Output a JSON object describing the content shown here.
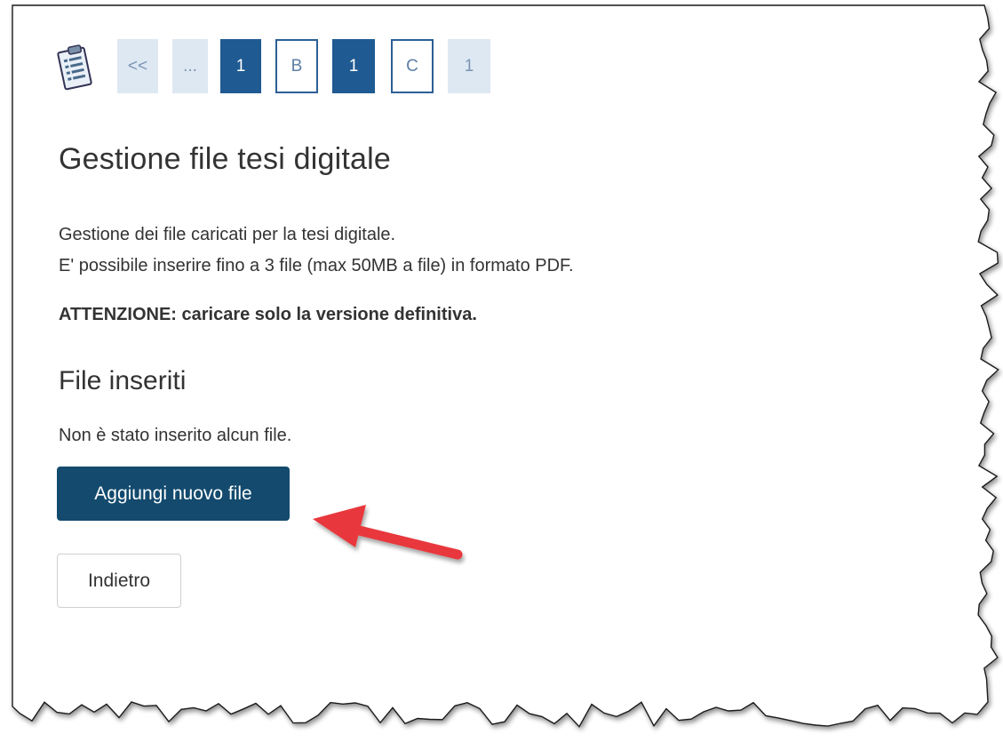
{
  "stepper": {
    "icon": "clipboard-checklist-icon",
    "steps": [
      {
        "label": "<<",
        "style": "light"
      },
      {
        "label": "...",
        "style": "light"
      },
      {
        "label": "1",
        "style": "filled"
      },
      {
        "label": "B",
        "style": "outline"
      },
      {
        "label": "1",
        "style": "filled"
      },
      {
        "label": "C",
        "style": "outline"
      },
      {
        "label": "1",
        "style": "light"
      }
    ]
  },
  "page": {
    "title": "Gestione file tesi digitale",
    "description_line1": "Gestione dei file caricati per la tesi digitale.",
    "description_line2": "E' possibile inserire fino a 3 file (max 50MB a file) in formato PDF.",
    "warning": "ATTENZIONE: caricare solo la versione definitiva."
  },
  "files_section": {
    "title": "File inseriti",
    "empty_message": "Non è stato inserito alcun file."
  },
  "buttons": {
    "add_file": "Aggiungi nuovo file",
    "back": "Indietro"
  },
  "annotation": {
    "arrow_icon": "red-arrow-icon",
    "arrow_color": "#e8383d"
  },
  "colors": {
    "primary": "#134a6e",
    "step_filled": "#1f5a92",
    "step_light": "#dde8f3",
    "text": "#333333"
  }
}
